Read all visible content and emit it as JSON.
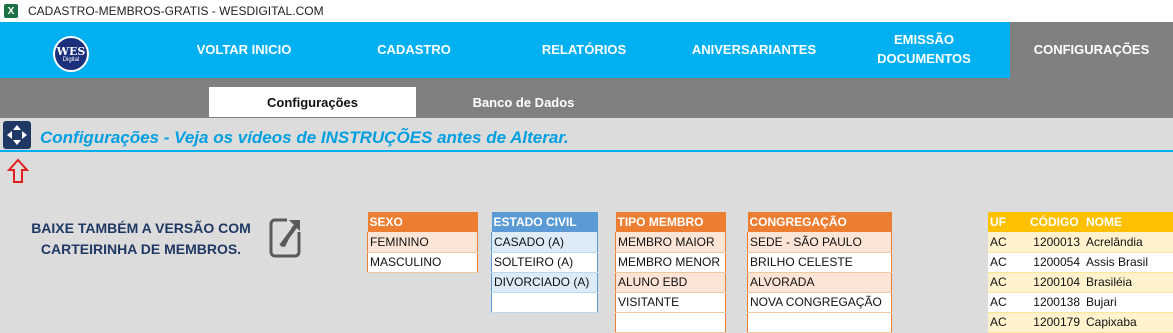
{
  "window": {
    "title": "CADASTRO-MEMBROS-GRATIS - WESDIGITAL.COM",
    "app_icon": "excel-icon"
  },
  "logo": {
    "line1": "WES",
    "line2": "Digital"
  },
  "nav": {
    "items": [
      {
        "label": "VOLTAR INICIO"
      },
      {
        "label": "CADASTRO"
      },
      {
        "label": "RELATÓRIOS"
      },
      {
        "label": "ANIVERSARIANTES"
      },
      {
        "label": "EMISSÃO\nDOCUMENTOS"
      },
      {
        "label": "CONFIGURAÇÕES"
      }
    ],
    "active": "CONFIGURAÇÕES"
  },
  "subtabs": {
    "items": [
      {
        "label": "Configurações"
      },
      {
        "label": "Banco de Dados"
      }
    ],
    "active": "Configurações"
  },
  "heading": "Configurações  - Veja os vídeos de INSTRUÇÕES antes de Alterar.",
  "promo": {
    "line1": "BAIXE TAMBÉM A VERSÃO COM",
    "line2": "CARTEIRINHA DE MEMBROS."
  },
  "tables": {
    "sexo": {
      "header": "SEXO",
      "rows": [
        "FEMININO",
        "MASCULINO"
      ]
    },
    "estado_civil": {
      "header": "ESTADO CIVIL",
      "rows": [
        "CASADO (A)",
        "SOLTEIRO (A)",
        "DIVORCIADO (A)"
      ]
    },
    "tipo_membro": {
      "header": "TIPO MEMBRO",
      "rows": [
        "MEMBRO MAIOR",
        "MEMBRO MENOR",
        "ALUNO EBD",
        "VISITANTE"
      ]
    },
    "congregacao": {
      "header": "CONGREGAÇÃO",
      "rows": [
        "SEDE - SÃO PAULO",
        "BRILHO CELESTE",
        "ALVORADA",
        "NOVA CONGREGAÇÃO"
      ]
    },
    "municipios": {
      "headers": [
        "UF",
        "CÓDIGO",
        "NOME"
      ],
      "rows": [
        [
          "AC",
          "1200013",
          "Acrelândia"
        ],
        [
          "AC",
          "1200054",
          "Assis Brasil"
        ],
        [
          "AC",
          "1200104",
          "Brasiléia"
        ],
        [
          "AC",
          "1200138",
          "Bujari"
        ],
        [
          "AC",
          "1200179",
          "Capixaba"
        ]
      ]
    }
  },
  "colors": {
    "nav_bg": "#00b0f0",
    "nav_active": "#808080",
    "orange": "#ed7d31",
    "blue": "#5b9bd5",
    "gold": "#ffc000",
    "heading": "#00a0e0",
    "promo": "#1f3864"
  }
}
